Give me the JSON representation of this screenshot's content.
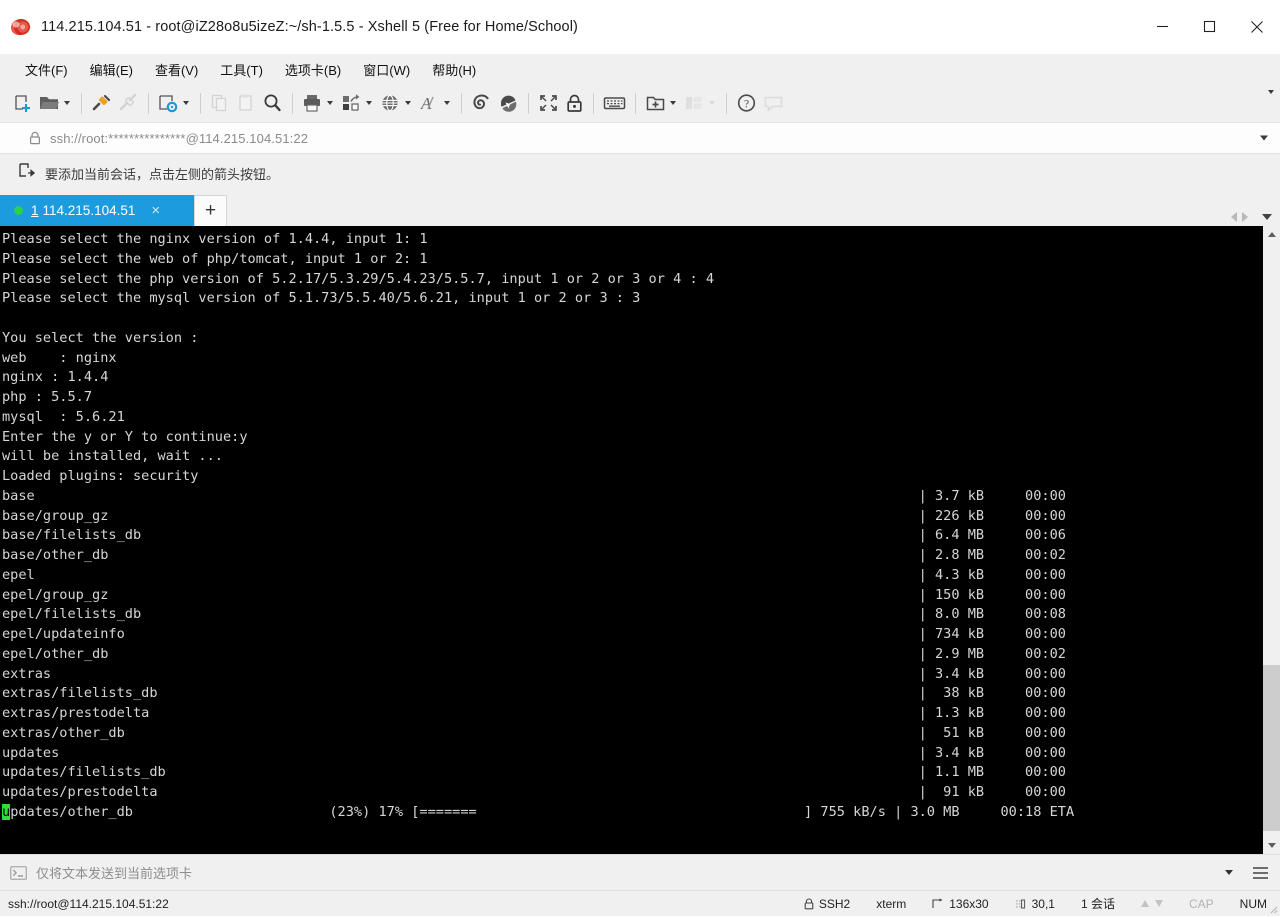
{
  "window": {
    "title": "114.215.104.51 - root@iZ28o8u5izeZ:~/sh-1.5.5 - Xshell 5 (Free for Home/School)",
    "minimize_label": "Minimize",
    "maximize_label": "Maximize",
    "close_label": "Close"
  },
  "menubar": {
    "items": [
      {
        "label": "文件(F)",
        "name": "menu-file"
      },
      {
        "label": "编辑(E)",
        "name": "menu-edit"
      },
      {
        "label": "查看(V)",
        "name": "menu-view"
      },
      {
        "label": "工具(T)",
        "name": "menu-tools"
      },
      {
        "label": "选项卡(B)",
        "name": "menu-tabs"
      },
      {
        "label": "窗口(W)",
        "name": "menu-window"
      },
      {
        "label": "帮助(H)",
        "name": "menu-help"
      }
    ]
  },
  "toolbar": {
    "buttons": [
      {
        "icon": "new-session-icon",
        "label": "新建会话"
      },
      {
        "icon": "open-folder-icon",
        "label": "打开"
      },
      {
        "icon": "connect-icon",
        "label": "连接"
      },
      {
        "icon": "disconnect-icon",
        "label": "断开"
      },
      {
        "icon": "session-properties-icon",
        "label": "属性"
      },
      {
        "icon": "copy-icon",
        "label": "复制"
      },
      {
        "icon": "paste-icon",
        "label": "粘贴"
      },
      {
        "icon": "find-icon",
        "label": "查找"
      },
      {
        "icon": "print-icon",
        "label": "打印"
      },
      {
        "icon": "file-transfer-icon",
        "label": "文件传输"
      },
      {
        "icon": "globe-icon",
        "label": "编码"
      },
      {
        "icon": "font-icon",
        "label": "字体"
      },
      {
        "icon": "xshell-icon",
        "label": "Xshell"
      },
      {
        "icon": "xftp-icon",
        "label": "Xftp"
      },
      {
        "icon": "fullscreen-icon",
        "label": "全屏"
      },
      {
        "icon": "lock-icon",
        "label": "锁定"
      },
      {
        "icon": "keyboard-icon",
        "label": "键盘"
      },
      {
        "icon": "add-folder-icon",
        "label": "新建文件夹"
      },
      {
        "icon": "layout-icon",
        "label": "排列"
      },
      {
        "icon": "help-icon",
        "label": "帮助"
      },
      {
        "icon": "chat-icon",
        "label": "聊天"
      }
    ],
    "overflow_label": "更多"
  },
  "address": {
    "value": "ssh://root:***************@114.215.104.51:22",
    "lock_icon": "lock-icon",
    "dropdown_label": "历史"
  },
  "hint": {
    "icon": "add-session-icon",
    "text": "要添加当前会话，点击左侧的箭头按钮。"
  },
  "tabs": {
    "items": [
      {
        "number": "1",
        "label": "114.215.104.51",
        "status": "connected",
        "close_label": "×"
      }
    ],
    "new_tab_label": "+",
    "scroll_left_label": "向左",
    "scroll_right_label": "向右",
    "tab_menu_label": "选项卡菜单"
  },
  "terminal": {
    "prompt_lines": [
      "Please select the nginx version of 1.4.4, input 1: 1",
      "Please select the web of php/tomcat, input 1 or 2: 1",
      "Please select the php version of 5.2.17/5.3.29/5.4.23/5.5.7, input 1 or 2 or 3 or 4 : 4",
      "Please select the mysql version of 5.1.73/5.5.40/5.6.21, input 1 or 2 or 3 : 3",
      "",
      "You select the version :",
      "web    : nginx",
      "nginx : 1.4.4",
      "php : 5.5.7",
      "mysql  : 5.6.21",
      "Enter the y or Y to continue:y",
      "will be installed, wait ...",
      "Loaded plugins: security"
    ],
    "repo_rows": [
      {
        "name": "base",
        "size": "3.7 kB",
        "time": "00:00"
      },
      {
        "name": "base/group_gz",
        "size": "226 kB",
        "time": "00:00"
      },
      {
        "name": "base/filelists_db",
        "size": "6.4 MB",
        "time": "00:06"
      },
      {
        "name": "base/other_db",
        "size": "2.8 MB",
        "time": "00:02"
      },
      {
        "name": "epel",
        "size": "4.3 kB",
        "time": "00:00"
      },
      {
        "name": "epel/group_gz",
        "size": "150 kB",
        "time": "00:00"
      },
      {
        "name": "epel/filelists_db",
        "size": "8.0 MB",
        "time": "00:08"
      },
      {
        "name": "epel/updateinfo",
        "size": "734 kB",
        "time": "00:00"
      },
      {
        "name": "epel/other_db",
        "size": "2.9 MB",
        "time": "00:02"
      },
      {
        "name": "extras",
        "size": "3.4 kB",
        "time": "00:00"
      },
      {
        "name": "extras/filelists_db",
        "size": "38 kB",
        "time": "00:00"
      },
      {
        "name": "extras/prestodelta",
        "size": "1.3 kB",
        "time": "00:00"
      },
      {
        "name": "extras/other_db",
        "size": "51 kB",
        "time": "00:00"
      },
      {
        "name": "updates",
        "size": "3.4 kB",
        "time": "00:00"
      },
      {
        "name": "updates/filelists_db",
        "size": "1.1 MB",
        "time": "00:00"
      },
      {
        "name": "updates/prestodelta",
        "size": "91 kB",
        "time": "00:00"
      }
    ],
    "active_row": {
      "cursor_char": "u",
      "name_rest": "pdates/other_db",
      "overall_pct": "(23%)",
      "item_pct": "17%",
      "bar": "[=======",
      "bar_close": "]",
      "rate": "755 kB/s",
      "size": "3.0 MB",
      "eta": "00:18 ETA"
    },
    "colors": {
      "background": "#000000",
      "foreground": "#d6d6d6",
      "cursor": "#27e03a"
    }
  },
  "sendbar": {
    "icon": "console-icon",
    "text": "仅将文本发送到当前选项卡",
    "dropdown_label": "发送目标",
    "menu_label": "菜单"
  },
  "statusbar": {
    "connection": "ssh://root@114.215.104.51:22",
    "protocol": "SSH2",
    "terminal_type": "xterm",
    "size": "136x30",
    "cursor_pos": "30,1",
    "sessions": "1 会话",
    "caps": "CAP",
    "num": "NUM",
    "protocol_icon": "lock-icon",
    "size_icon": "resize-icon",
    "cursor_icon": "cursor-icon"
  }
}
